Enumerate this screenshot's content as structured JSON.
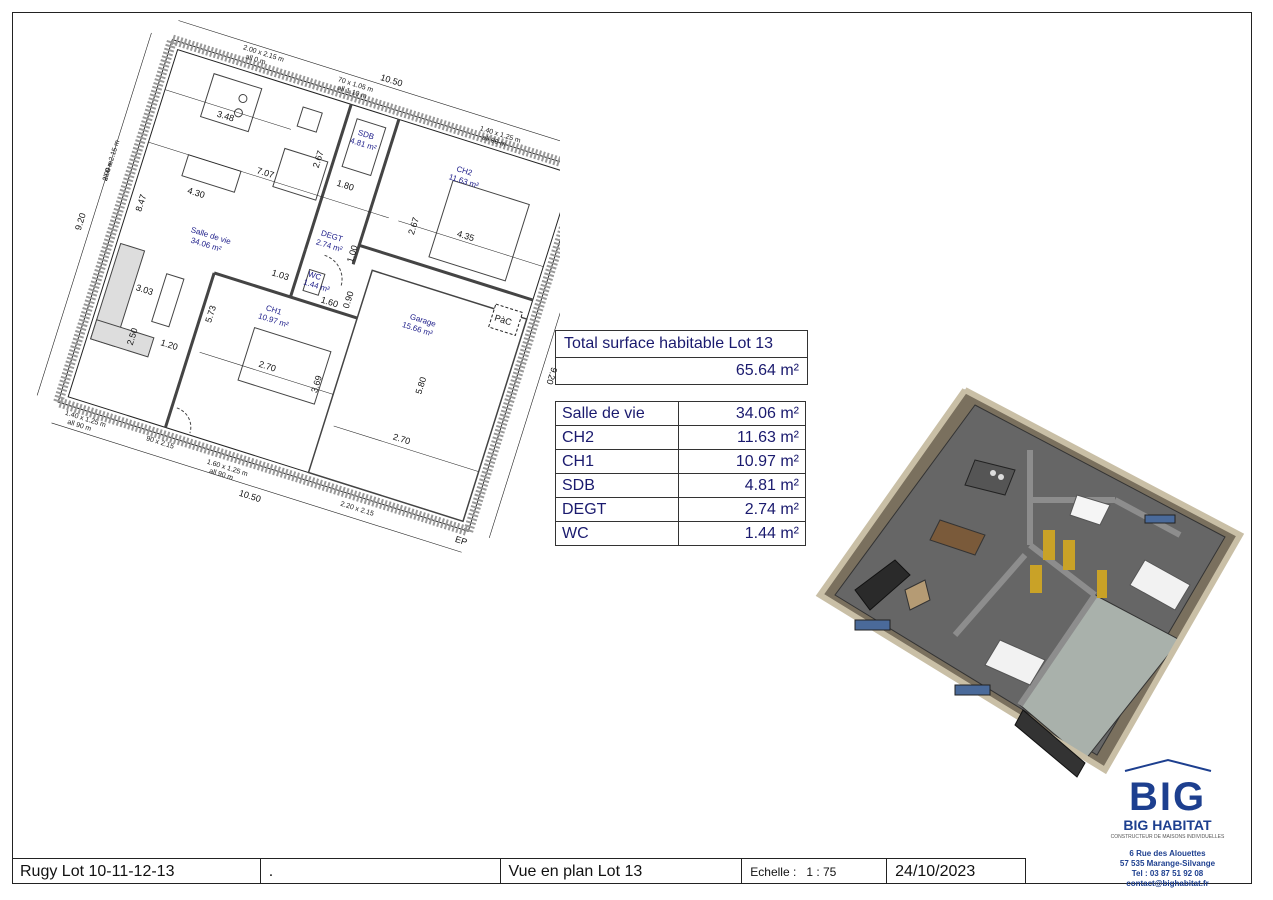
{
  "plan": {
    "rooms": [
      {
        "name": "SDB",
        "area": "4.81 m²"
      },
      {
        "name": "CH2",
        "area": "11.63 m²"
      },
      {
        "name": "DEGT",
        "area": "2.74 m²"
      },
      {
        "name": "Salle de vie",
        "area": "34.06 m²"
      },
      {
        "name": "WC",
        "area": "1.44 m²"
      },
      {
        "name": "CH1",
        "area": "10.97 m²"
      },
      {
        "name": "Garage",
        "area": "15.66 m²"
      }
    ],
    "dimensions": {
      "top_total": "10.50",
      "bottom_total": "10.50",
      "left_total": "9.20",
      "right_total": "9.20",
      "d_3_48": "3.48",
      "d_2_67a": "2.67",
      "d_1_80": "1.80",
      "d_2_67b": "2.67",
      "d_7_07": "7.07",
      "d_4_35": "4.35",
      "d_8_47": "8.47",
      "d_4_30": "4.30",
      "d_1_03": "1.03",
      "d_1_00": "1.00",
      "d_1_60": "1.60",
      "d_0_90": "0.90",
      "d_5_73": "5.73",
      "d_3_03": "3.03",
      "d_2_50": "2.50",
      "d_1_20": "1.20",
      "d_2_70a": "2.70",
      "d_3_69": "3.69",
      "d_5_80": "5.80",
      "d_2_70b": "2.70"
    },
    "openings": {
      "o1": "2.00 x 2.15 m",
      "o1b": "all 0 m",
      "o2": "70 x 1.05 m",
      "o2b": "all 1.10 m",
      "o3": "1.40 x 1.25 m",
      "o3b": "all 90 m",
      "o4": "2.00 x 2.15 m",
      "o4b": "all 0 m",
      "o5": "1.40 x 1.25 m",
      "o5b": "all 90 m",
      "o6": "90 x 2.15",
      "o7": "1.60 x 1.25 m",
      "o7b": "all 90 m",
      "o8": "2.20 x 2.15"
    },
    "ep_top": "EP",
    "ep_bottom": "EP",
    "pac": "PàC"
  },
  "total": {
    "title": "Total surface habitable Lot 13",
    "value": "65.64 m²"
  },
  "areas_table": [
    {
      "room": "Salle de vie",
      "area": "34.06 m²"
    },
    {
      "room": "CH2",
      "area": "11.63 m²"
    },
    {
      "room": "CH1",
      "area": "10.97 m²"
    },
    {
      "room": "SDB",
      "area": "4.81 m²"
    },
    {
      "room": "DEGT",
      "area": "2.74 m²"
    },
    {
      "room": "WC",
      "area": "1.44 m²"
    }
  ],
  "footer": {
    "project": "Rugy Lot 10-11-12-13",
    "blank": ".",
    "view": "Vue en plan Lot 13",
    "scale_label": "Echelle :",
    "scale_value": "1 : 75",
    "date": "24/10/2023"
  },
  "company": {
    "logo_letters": "BIG",
    "name": "BIG HABITAT",
    "tagline": "CONSTRUCTEUR DE MAISONS INDIVIDUELLES",
    "street": "6 Rue des Alouettes",
    "city": "57 535 Marange-Silvange",
    "tel": "Tel : 03 87 51 92 08",
    "email": "contact@bighabitat.fr"
  },
  "colors": {
    "accent": "#1d3f8f",
    "wall_3d": "#8a7f6a",
    "floor_3d": "#6e6e6e",
    "garage_3d": "#a9b1ab",
    "door_3d": "#c9a227"
  }
}
